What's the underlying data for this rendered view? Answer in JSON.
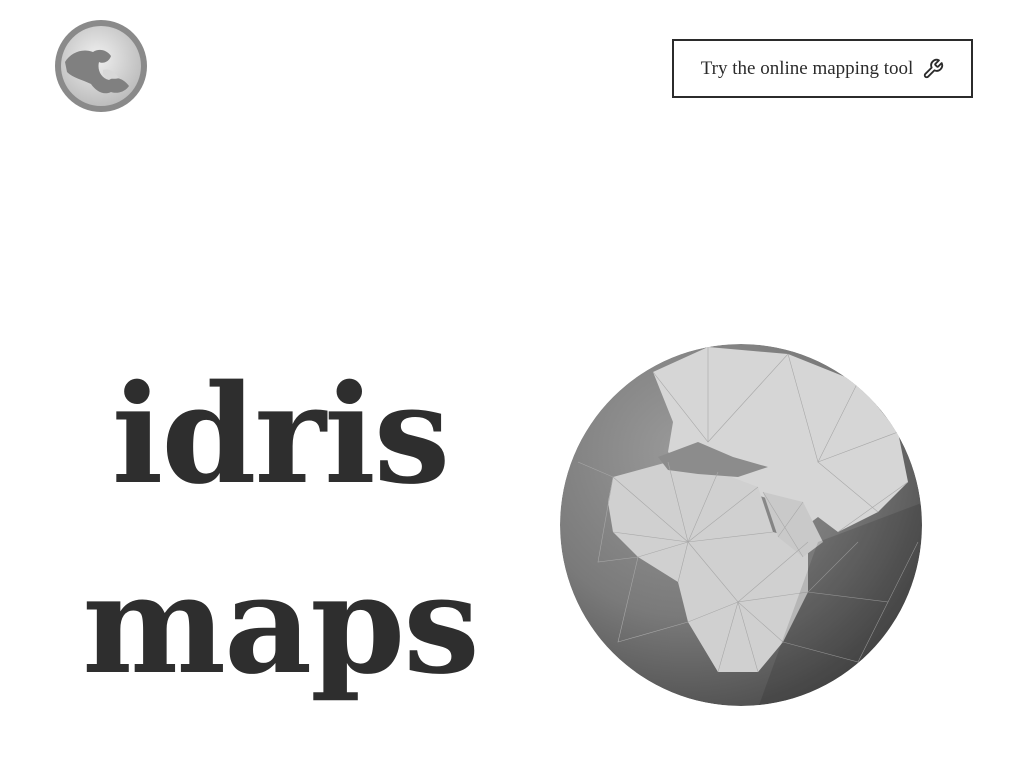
{
  "header": {
    "logo_icon": "globe-logo-icon",
    "cta_label": "Try the online mapping tool",
    "cta_icon": "wrench-icon"
  },
  "hero": {
    "title_line1": "idris",
    "title_line2": "maps",
    "globe_icon": "low-poly-globe-illustration"
  },
  "colors": {
    "text": "#2b2b2b",
    "background": "#ffffff",
    "globe_land": "#dcdcdc",
    "globe_sea": "#7a7a7a"
  }
}
